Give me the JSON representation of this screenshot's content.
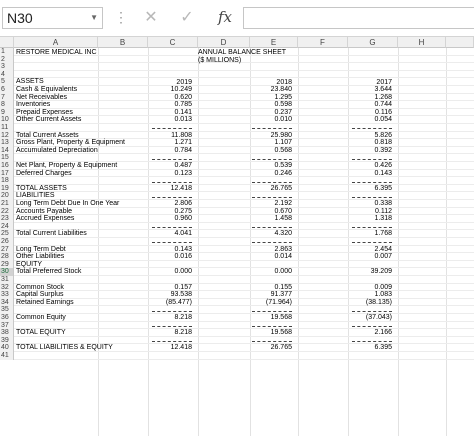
{
  "name_box": "N30",
  "formula_bar": {
    "fx_label": "fx",
    "content": ""
  },
  "columns": [
    "A",
    "B",
    "C",
    "D",
    "E",
    "F",
    "G",
    "H"
  ],
  "selected_row": 30,
  "row_count": 41,
  "header": {
    "company": "RESTORE MEDICAL INC",
    "title_line1": "ANNUAL BALANCE SHEET",
    "title_line2": "($ MILLIONS)",
    "years": [
      "2019",
      "2018",
      "2017"
    ]
  },
  "rows": [
    {
      "r": 5,
      "label": "ASSETS"
    },
    {
      "r": 6,
      "label": "Cash & Equivalents",
      "v": [
        "10.249",
        "23.840",
        "3.644"
      ]
    },
    {
      "r": 7,
      "label": "Net Receivables",
      "v": [
        "0.620",
        "1.295",
        "1.268"
      ]
    },
    {
      "r": 8,
      "label": "Inventories",
      "v": [
        "0.785",
        "0.598",
        "0.744"
      ]
    },
    {
      "r": 9,
      "label": "Prepaid Expenses",
      "v": [
        "0.141",
        "0.237",
        "0.116"
      ]
    },
    {
      "r": 10,
      "label": "Other Current Assets",
      "v": [
        "0.013",
        "0.010",
        "0.054"
      ]
    },
    {
      "r": 12,
      "label": "Total Current Assets",
      "v": [
        "11.808",
        "25.980",
        "5.826"
      ]
    },
    {
      "r": 13,
      "label": "Gross Plant, Property & Equipment",
      "v": [
        "1.271",
        "1.107",
        "0.818"
      ]
    },
    {
      "r": 14,
      "label": "Accumulated Depreciation",
      "v": [
        "0.784",
        "0.568",
        "0.392"
      ]
    },
    {
      "r": 16,
      "label": "Net Plant, Property & Equipment",
      "v": [
        "0.487",
        "0.539",
        "0.426"
      ]
    },
    {
      "r": 17,
      "label": "Deferred Charges",
      "v": [
        "0.123",
        "0.246",
        "0.143"
      ]
    },
    {
      "r": 19,
      "label": "TOTAL ASSETS",
      "v": [
        "12.418",
        "26.765",
        "6.395"
      ]
    },
    {
      "r": 20,
      "label": "LIABILITIES"
    },
    {
      "r": 21,
      "label": "Long Term Debt Due In One Year",
      "v": [
        "2.806",
        "2.192",
        "0.338"
      ]
    },
    {
      "r": 22,
      "label": "Accounts Payable",
      "v": [
        "0.275",
        "0.670",
        "0.112"
      ]
    },
    {
      "r": 23,
      "label": "Accrued Expenses",
      "v": [
        "0.960",
        "1.458",
        "1.318"
      ]
    },
    {
      "r": 25,
      "label": "Total Current Liabilities",
      "v": [
        "4.041",
        "4.320",
        "1.768"
      ]
    },
    {
      "r": 27,
      "label": "Long Term Debt",
      "v": [
        "0.143",
        "2.863",
        "2.454"
      ]
    },
    {
      "r": 28,
      "label": "Other Liabilities",
      "v": [
        "0.016",
        "0.014",
        "0.007"
      ]
    },
    {
      "r": 29,
      "label": "EQUITY"
    },
    {
      "r": 30,
      "label": "Total Preferred Stock",
      "v": [
        "0.000",
        "0.000",
        "39.209"
      ]
    },
    {
      "r": 32,
      "label": "Common Stock",
      "v": [
        "0.157",
        "0.155",
        "0.009"
      ]
    },
    {
      "r": 33,
      "label": "Capital Surplus",
      "v": [
        "93.538",
        "91.377",
        "1.083"
      ]
    },
    {
      "r": 34,
      "label": "Retained Earnings",
      "v": [
        "(85.477)",
        "(71.964)",
        "(38.135)"
      ]
    },
    {
      "r": 36,
      "label": "Common Equity",
      "v": [
        "8.218",
        "19.568",
        "(37.043)"
      ]
    },
    {
      "r": 38,
      "label": "TOTAL EQUITY",
      "v": [
        "8.218",
        "19.568",
        "2.166"
      ]
    },
    {
      "r": 40,
      "label": "TOTAL LIABILITIES & EQUITY",
      "v": [
        "12.418",
        "26.765",
        "6.395"
      ]
    }
  ],
  "dash_rows": [
    10.7,
    14.7,
    17.7,
    23.7,
    25.7,
    34.7,
    36.7,
    38.7
  ],
  "double_rows": [
    19.8
  ]
}
